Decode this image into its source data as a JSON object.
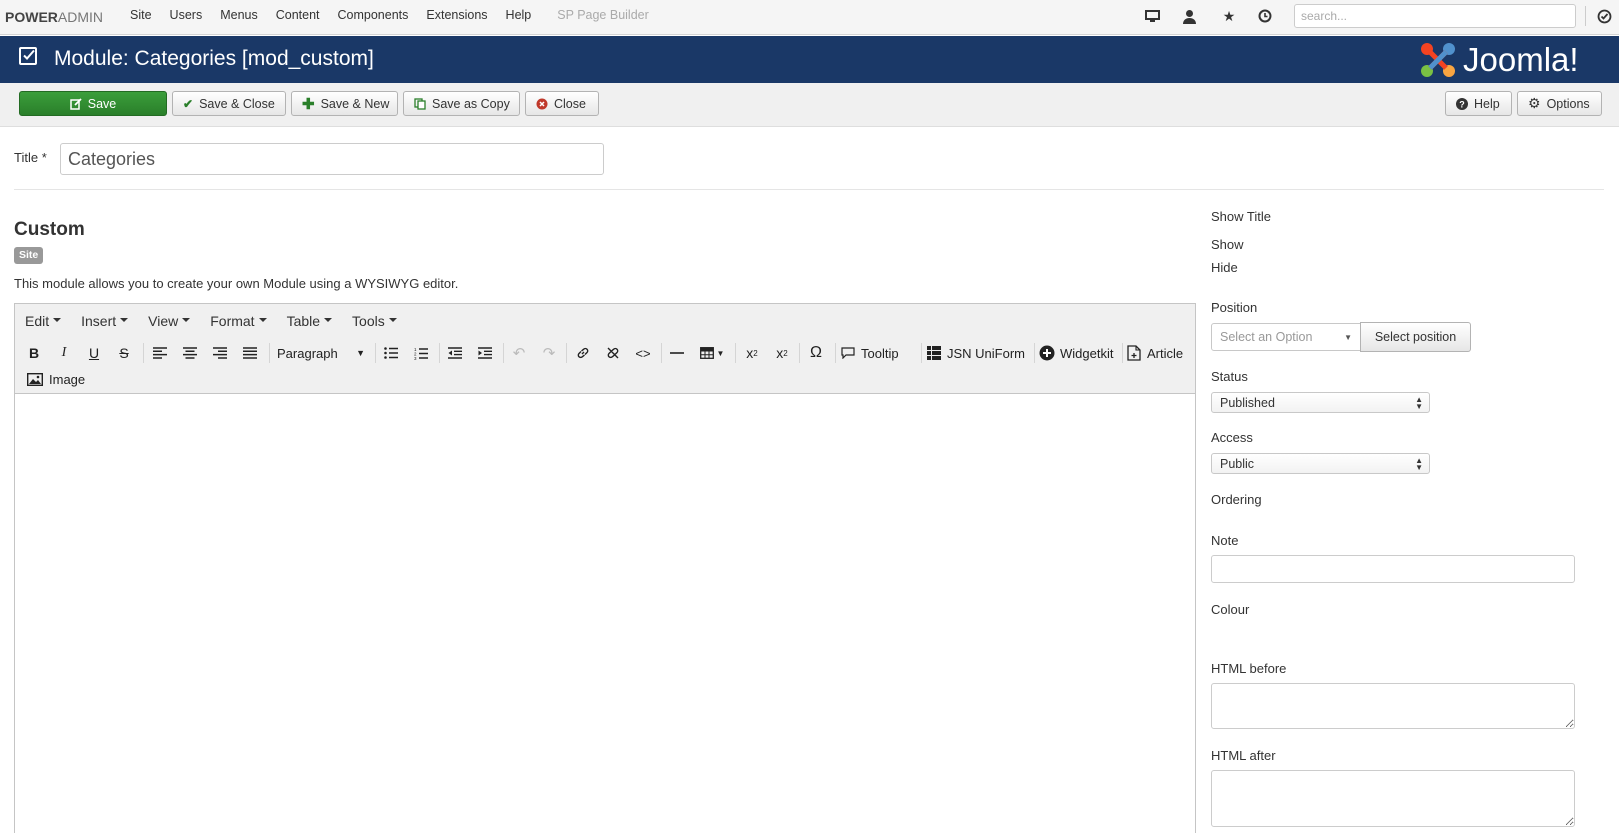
{
  "topnav": {
    "brand_left": "POWER",
    "brand_right": "ADMIN",
    "menu": [
      "Site",
      "Users",
      "Menus",
      "Content",
      "Components",
      "Extensions",
      "Help",
      "SP Page Builder"
    ],
    "icons": [
      "monitor-icon",
      "user-icon",
      "star-icon",
      "clock-icon",
      "check-circle-icon"
    ],
    "search_placeholder": "search..."
  },
  "header": {
    "title": "Module: Categories [mod_custom]",
    "logo_text": "Joomla!"
  },
  "toolbar": {
    "save": "Save",
    "save_close": "Save & Close",
    "save_new": "Save & New",
    "save_copy": "Save as Copy",
    "close": "Close",
    "help": "Help",
    "options": "Options"
  },
  "form": {
    "title_label": "Title *",
    "title_value": "Categories"
  },
  "module": {
    "name": "Custom",
    "badge": "Site",
    "description": "This module allows you to create your own Module using a WYSIWYG editor."
  },
  "editor": {
    "menubar": [
      "Edit",
      "Insert",
      "View",
      "Format",
      "Table",
      "Tools"
    ],
    "format_select": "Paragraph",
    "tooltip": "Tooltip",
    "jsn_uniform": "JSN UniForm",
    "widgetkit": "Widgetkit",
    "article": "Article",
    "image": "Image"
  },
  "sidebar": {
    "show_title_label": "Show Title",
    "show_label": "Show",
    "hide_label": "Hide",
    "position_label": "Position",
    "position_placeholder": "Select an Option",
    "select_position": "Select position",
    "status_label": "Status",
    "status_value": "Published",
    "access_label": "Access",
    "access_value": "Public",
    "ordering_label": "Ordering",
    "note_label": "Note",
    "colour_label": "Colour",
    "html_before_label": "HTML before",
    "html_after_label": "HTML after"
  },
  "colors": {
    "header_bg": "#1a3867",
    "save_green": "#2f8f2f",
    "close_icon_red": "#c0392b"
  }
}
